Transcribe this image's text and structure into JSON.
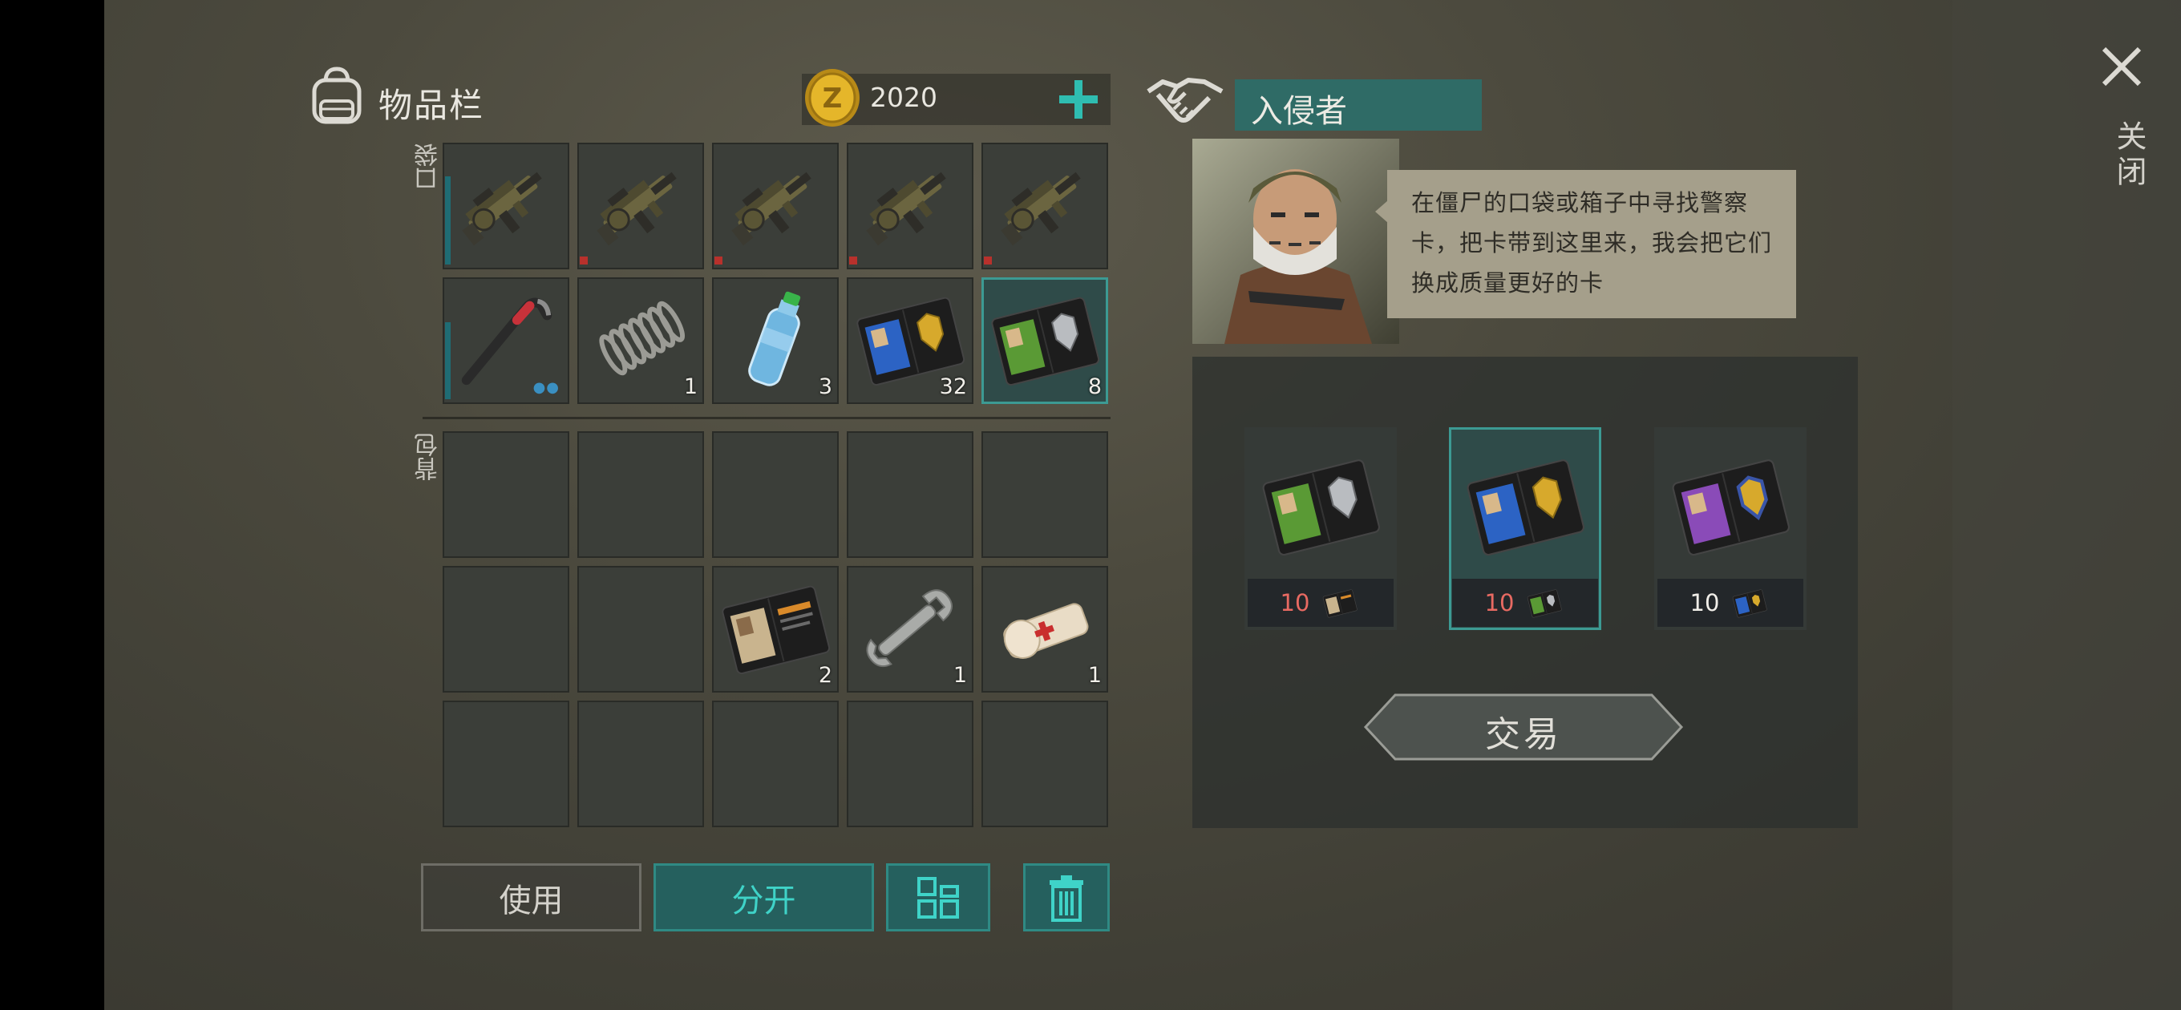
{
  "header": {
    "title": "物品栏",
    "coins": "2020"
  },
  "sections": {
    "pocket": "口袋",
    "backpack": "背包"
  },
  "pocket_row1": [
    {
      "icon": "grenade-launcher-icon",
      "durability": 0.7
    },
    {
      "icon": "grenade-launcher-icon",
      "durability": 0.05
    },
    {
      "icon": "grenade-launcher-icon",
      "durability": 0.05
    },
    {
      "icon": "grenade-launcher-icon",
      "durability": 0.05
    },
    {
      "icon": "grenade-launcher-icon",
      "durability": 0.05
    }
  ],
  "pocket_row2": [
    {
      "icon": "crowbar-icon",
      "qty": "",
      "durability": 0.6
    },
    {
      "icon": "spring-icon",
      "qty": "1"
    },
    {
      "icon": "water-bottle-icon",
      "qty": "3"
    },
    {
      "icon": "blue-police-card-icon",
      "qty": "32"
    },
    {
      "icon": "green-police-card-icon",
      "qty": "8"
    }
  ],
  "backpack_items": [
    {
      "icon": "patrol-officer-card-icon",
      "qty": "2"
    },
    {
      "icon": "wrench-icon",
      "qty": "1"
    },
    {
      "icon": "bandage-icon",
      "qty": "1"
    }
  ],
  "buttons": {
    "use": "使用",
    "split": "分开"
  },
  "trader": {
    "name": "入侵者",
    "speech": "在僵尸的口袋或箱子中寻找警察卡，把卡带到这里来，我会把它们换成质量更好的卡"
  },
  "offers": [
    {
      "icon": "green-police-card-icon",
      "price": "10",
      "price_color": "#e86a62",
      "cost_icon": "patrol-officer-card-icon"
    },
    {
      "icon": "blue-police-card-icon",
      "price": "10",
      "price_color": "#e86a62",
      "cost_icon": "green-police-card-icon"
    },
    {
      "icon": "purple-police-card-icon",
      "price": "10",
      "price_color": "#f0eee8",
      "cost_icon": "blue-police-card-icon"
    }
  ],
  "trade_button": "交易",
  "close_label": "关闭",
  "colors": {
    "accent": "#2f8a84",
    "accent_text": "#3fd3c8",
    "selected_slot": "#2f4b49"
  }
}
